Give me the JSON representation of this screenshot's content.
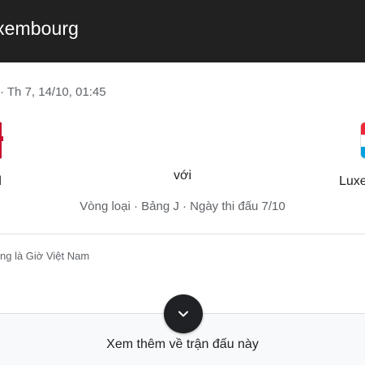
{
  "header": {
    "title": "xembourg"
  },
  "match": {
    "datetime": "· Th 7, 14/10, 01:45",
    "home_team": "d",
    "away_team": "Luxe",
    "vs_label": "với",
    "stage": "Vòng loại · Bảng J · Ngày thi đấu 7/10",
    "timezone_note": "ng là Giờ Việt Nam"
  },
  "footer": {
    "more_label": "Xem thêm về trận đấu này",
    "expand_icon": "chevron-down-icon"
  },
  "colors": {
    "header_bg": "#212121",
    "button_bg": "#202124",
    "muted_text": "#5f6368"
  }
}
